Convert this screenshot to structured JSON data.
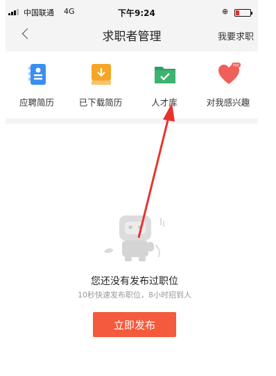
{
  "status_bar": {
    "carrier": "中国联通",
    "network": "4G",
    "time": "下午9:24"
  },
  "nav": {
    "title": "求职者管理",
    "right_link": "我要求职"
  },
  "categories": [
    {
      "label": "应聘简历",
      "icon": "resume-icon",
      "color": "#3a8ef0"
    },
    {
      "label": "已下载简历",
      "icon": "download-icon",
      "color": "#f5a623"
    },
    {
      "label": "人才库",
      "icon": "talent-folder-icon",
      "color": "#3cb371"
    },
    {
      "label": "对我感兴趣",
      "icon": "heart-icon",
      "color": "#f0605a",
      "badge": "Hot"
    }
  ],
  "empty_state": {
    "title": "您还没有发布过职位",
    "subtitle": "10秒快速发布职位，8小时招到人",
    "button": "立即发布"
  },
  "colors": {
    "accent": "#f45a3c",
    "annotation_arrow": "#e8322c"
  }
}
